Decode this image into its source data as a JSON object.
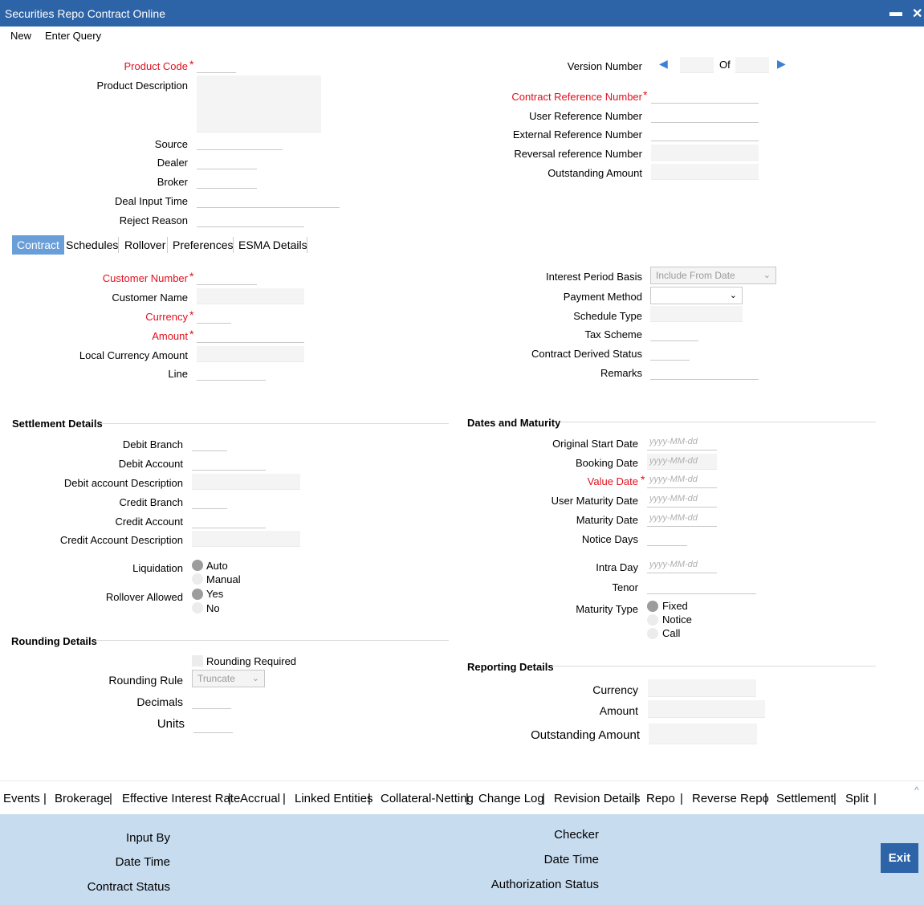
{
  "window": {
    "title": "Securities Repo Contract Online",
    "minimize": "▬",
    "close": "✕"
  },
  "menu": {
    "new": "New",
    "enter_query": "Enter Query"
  },
  "header": {
    "product_code": "Product Code",
    "product_description": "Product Description",
    "source": "Source",
    "dealer": "Dealer",
    "broker": "Broker",
    "deal_input_time": "Deal Input Time",
    "reject_reason": "Reject Reason",
    "version_number": "Version Number",
    "of": "Of",
    "contract_reference_number": "Contract Reference Number",
    "user_reference_number": "User Reference Number",
    "external_reference_number": "External Reference Number",
    "reversal_reference_number": "Reversal reference Number",
    "outstanding_amount": "Outstanding Amount"
  },
  "tabs": [
    "Contract",
    "Schedules",
    "Rollover",
    "Preferences",
    "ESMA Details"
  ],
  "contract": {
    "customer_number": "Customer Number",
    "customer_name": "Customer Name",
    "currency": "Currency",
    "amount": "Amount",
    "local_currency_amount": "Local Currency Amount",
    "line": "Line",
    "interest_period_basis": "Interest Period Basis",
    "interest_period_basis_value": "Include From Date",
    "payment_method": "Payment Method",
    "schedule_type": "Schedule Type",
    "tax_scheme": "Tax Scheme",
    "contract_derived_status": "Contract Derived Status",
    "remarks": "Remarks"
  },
  "settlement": {
    "title": "Settlement Details",
    "debit_branch": "Debit Branch",
    "debit_account": "Debit Account",
    "debit_account_description": "Debit account Description",
    "credit_branch": "Credit Branch",
    "credit_account": "Credit Account",
    "credit_account_description": "Credit Account Description",
    "liquidation": "Liquidation",
    "auto": "Auto",
    "manual": "Manual",
    "rollover_allowed": "Rollover Allowed",
    "yes": "Yes",
    "no": "No"
  },
  "dates": {
    "title": "Dates and Maturity",
    "original_start_date": "Original Start Date",
    "booking_date": "Booking Date",
    "value_date": "Value Date",
    "user_maturity_date": "User Maturity Date",
    "maturity_date": "Maturity Date",
    "notice_days": "Notice Days",
    "intra_day": "Intra Day",
    "tenor": "Tenor",
    "maturity_type": "Maturity Type",
    "fixed": "Fixed",
    "notice": "Notice",
    "call": "Call",
    "date_placeholder": "yyyy-MM-dd"
  },
  "rounding": {
    "title": "Rounding Details",
    "rounding_required": "Rounding Required",
    "rounding_rule": "Rounding Rule",
    "rounding_rule_value": "Truncate",
    "decimals": "Decimals",
    "units": "Units"
  },
  "reporting": {
    "title": "Reporting Details",
    "currency": "Currency",
    "amount": "Amount",
    "outstanding_amount": "Outstanding Amount"
  },
  "bottom_tabs": [
    "Events",
    "Brokerage",
    "Effective Interest Rate",
    "Accrual",
    "Linked Entities",
    "Collateral-Netting",
    "Change Log",
    "Revision Details",
    "Repo",
    "Reverse Repo",
    "Settlement",
    "Split"
  ],
  "footer": {
    "input_by": "Input By",
    "date_time": "Date Time",
    "contract_status": "Contract Status",
    "checker": "Checker",
    "date_time_2": "Date Time",
    "authorization_status": "Authorization Status",
    "exit": "Exit"
  },
  "colors": {
    "title_bar": "#2d64a7",
    "required": "#e0101e",
    "footer": "#c7dcef",
    "active_tab": "#6a9ed8"
  }
}
